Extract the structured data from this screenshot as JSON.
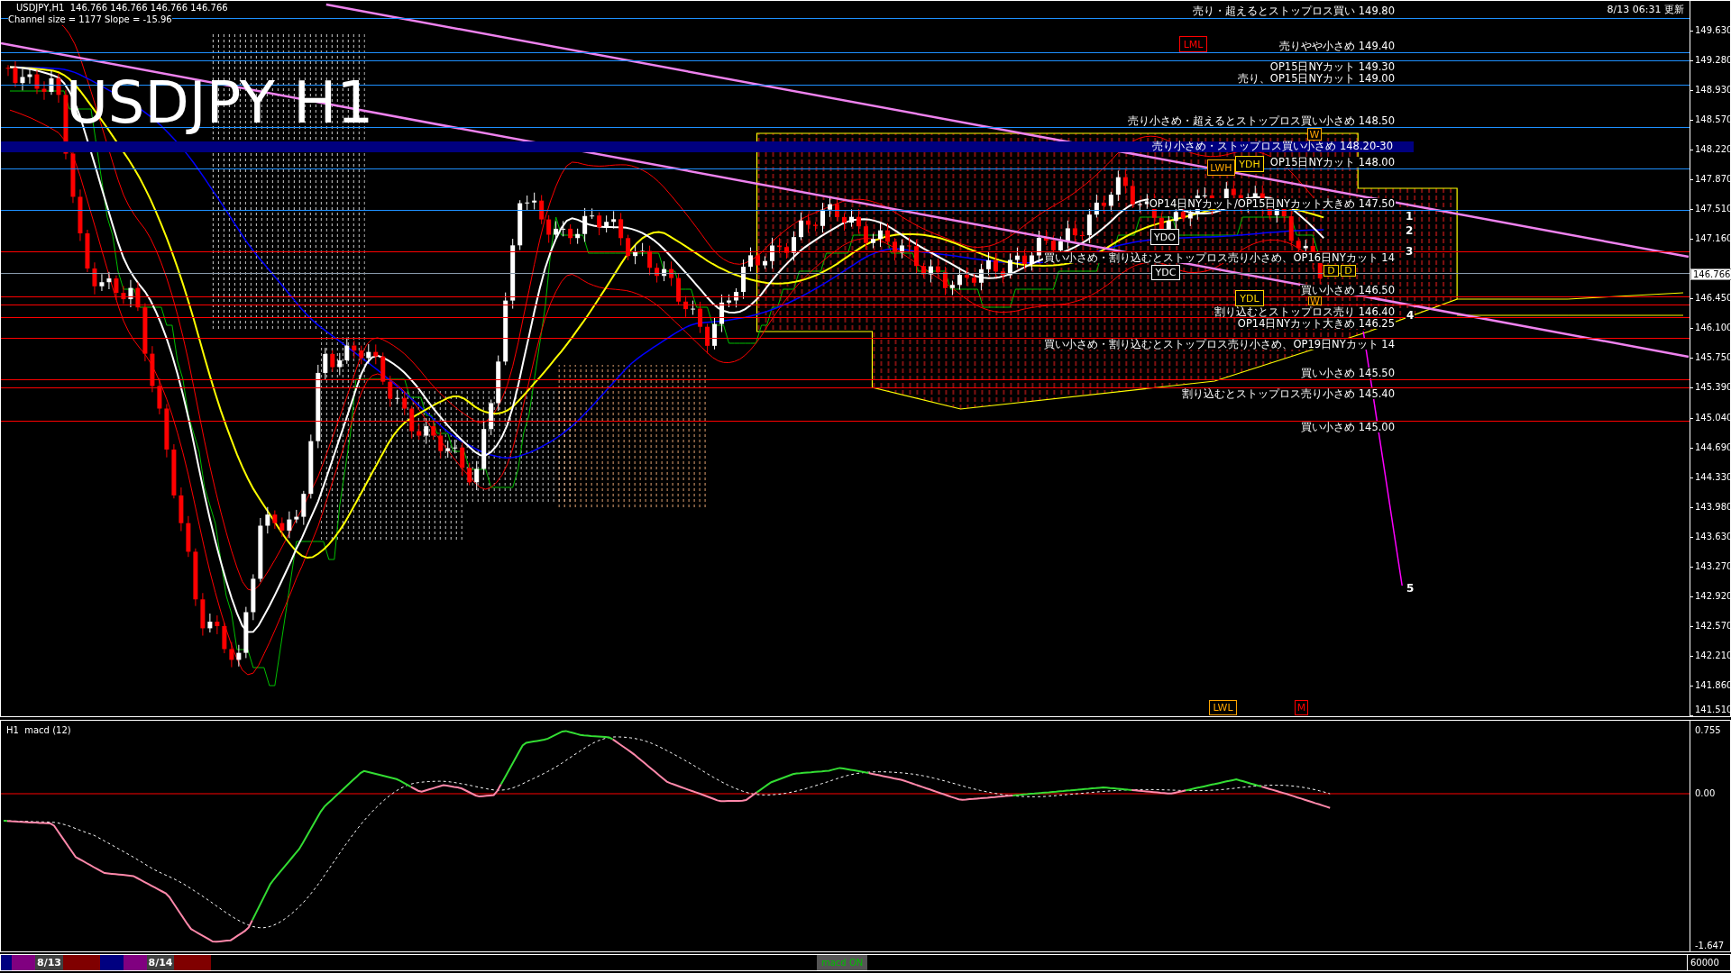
{
  "chart_header": {
    "symbol_line": "USDJPY,H1  146.766 146.766 146.766 146.766",
    "channel_info": "Channel size = 1177 Slope = -15.96",
    "title": "USDJPY H1",
    "updated": "8/13 06:31 更新"
  },
  "price_levels": [
    {
      "kind": "resistance",
      "label": "売り・超えるとストップロス買い 149.80",
      "color": "#1e90ff"
    },
    {
      "kind": "resistance",
      "label": "売りやや小さめ 149.40",
      "color": "#1e90ff"
    },
    {
      "kind": "resistance",
      "label": "OP15日NYカット 149.30",
      "color": "#1e90ff"
    },
    {
      "kind": "resistance",
      "label": "売り、OP15日NYカット 149.00",
      "color": "#1e90ff"
    },
    {
      "kind": "resistance",
      "label": "売り小さめ・超えるとストップロス買い小さめ 148.50",
      "color": "#1e90ff"
    },
    {
      "kind": "band",
      "label": "売り小さめ・ストップロス買い小さめ 148.20-30",
      "color": "#000080"
    },
    {
      "kind": "resistance",
      "label": "OP15日NYカット 148.00",
      "color": "#1e90ff"
    },
    {
      "kind": "resistance",
      "label": "OP14日NYカット/OP15日NYカット大きめ 147.50",
      "color": "#1e90ff"
    },
    {
      "kind": "support",
      "label": "買い小さめ・割り込むとストップロス売り小さめ、OP16日NYカット 14",
      "color": "#ff0000"
    },
    {
      "kind": "support",
      "label": "買い小さめ 146.50",
      "color": "#ff0000"
    },
    {
      "kind": "support",
      "label": "割り込むとストップロス売り 146.40",
      "color": "#ff0000"
    },
    {
      "kind": "support",
      "label": "OP14日NYカット大きめ 146.25",
      "color": "#ff0000"
    },
    {
      "kind": "support",
      "label": "買い小さめ・割り込むとストップロス売り小さめ、OP19日NYカット 14",
      "color": "#ff0000"
    },
    {
      "kind": "support",
      "label": "買い小さめ 145.50",
      "color": "#ff0000"
    },
    {
      "kind": "support",
      "label": "割り込むとストップロス売り小さめ 145.40",
      "color": "#ff0000"
    },
    {
      "kind": "support",
      "label": "買い小さめ 145.00",
      "color": "#ff0000"
    }
  ],
  "current_price": {
    "label": "146.766"
  },
  "markers": [
    {
      "label": "LML",
      "color": "#ff0000"
    },
    {
      "label": "W",
      "color": "#ffa500"
    },
    {
      "label": "LWH",
      "color": "#ffa500"
    },
    {
      "label": "YDH",
      "color": "#ffd700"
    },
    {
      "label": "YDO",
      "color": "#ffffff"
    },
    {
      "label": "YDC",
      "color": "#ffffff"
    },
    {
      "label": "D",
      "color": "#ffd700"
    },
    {
      "label": "D",
      "color": "#ffd700"
    },
    {
      "label": "YDL",
      "color": "#ffd700"
    },
    {
      "label": "W",
      "color": "#ffa500"
    },
    {
      "label": "LWL",
      "color": "#ffa500"
    },
    {
      "label": "M",
      "color": "#ff0000"
    }
  ],
  "wave_labels": [
    "1",
    "2",
    "3",
    "4",
    "5"
  ],
  "price_axis": {
    "ticks": [
      "149.630",
      "149.280",
      "148.930",
      "148.570",
      "148.220",
      "147.870",
      "147.510",
      "147.160",
      "146.450",
      "146.100",
      "145.750",
      "145.390",
      "145.040",
      "144.690",
      "144.330",
      "143.980",
      "143.630",
      "143.270",
      "142.920",
      "142.570",
      "142.210",
      "141.860",
      "141.510"
    ]
  },
  "macd_panel": {
    "title": "H1  macd (12)",
    "axis": [
      "0.755",
      "0.00",
      "-1.647"
    ]
  },
  "session_bar": {
    "segments": [
      {
        "color": "#000080"
      },
      {
        "color": "#800080"
      },
      {
        "color": "#404040",
        "label": "8/13"
      },
      {
        "color": "#800000"
      },
      {
        "color": "#000080"
      },
      {
        "color": "#800080"
      },
      {
        "color": "#404040",
        "label": "8/14"
      },
      {
        "color": "#800000"
      }
    ],
    "indicator_button": "macd ON",
    "volume_scale": "60000"
  }
}
